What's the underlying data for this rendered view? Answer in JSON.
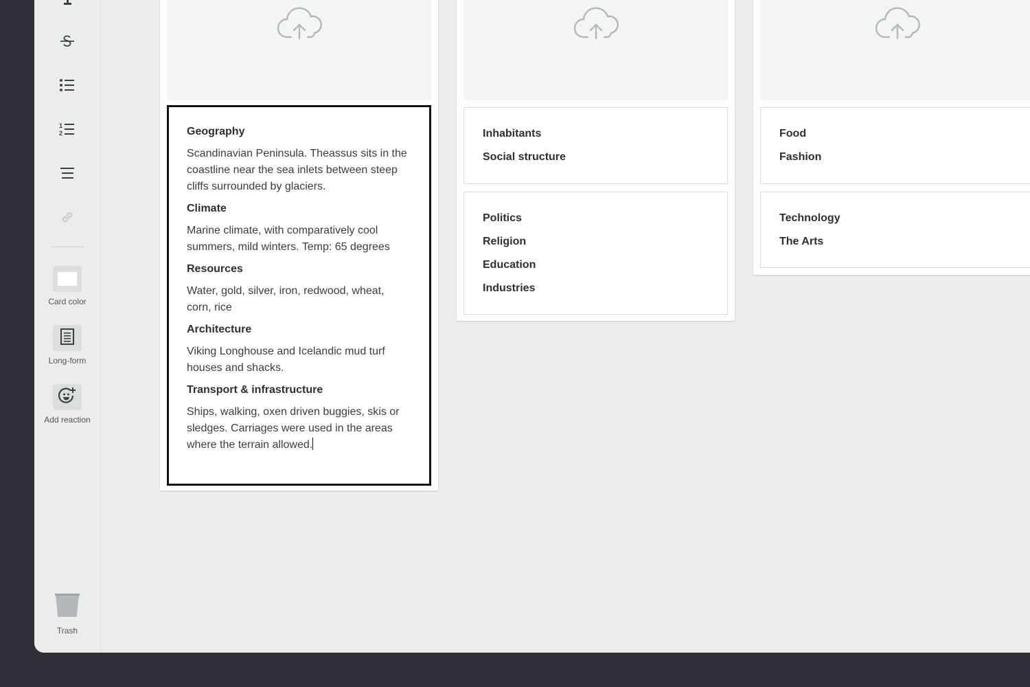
{
  "sidebar": {
    "tools": [
      {
        "name": "text-style",
        "icon": "text-icon"
      },
      {
        "name": "strikethrough",
        "icon": "strikethrough-icon"
      },
      {
        "name": "bulleted-list",
        "icon": "bulleted-list-icon"
      },
      {
        "name": "numbered-list",
        "icon": "numbered-list-icon"
      },
      {
        "name": "align",
        "icon": "align-icon"
      },
      {
        "name": "link",
        "icon": "link-icon",
        "disabled": true
      }
    ],
    "card_color_label": "Card color",
    "long_form_label": "Long-form",
    "add_reaction_label": "Add reaction",
    "trash_label": "Trash"
  },
  "columns": [
    {
      "cards": [
        {
          "active": true,
          "sections": [
            {
              "heading": "Geography",
              "text": "Scandinavian Peninsula. Theassus sits in the coastline near the sea inlets between steep cliffs surrounded by glaciers."
            },
            {
              "heading": "Climate",
              "text": "Marine climate, with comparatively cool summers, mild winters. Temp: 65 degrees"
            },
            {
              "heading": "Resources",
              "text": "Water, gold, silver, iron, redwood, wheat, corn, rice"
            },
            {
              "heading": "Architecture",
              "text": "Viking Longhouse and Icelandic mud turf houses and shacks."
            },
            {
              "heading": "Transport & infrastructure",
              "text": "Ships, walking, oxen driven buggies, skis or sledges. Carriages were used in the areas where the terrain allowed."
            }
          ]
        }
      ]
    },
    {
      "cards": [
        {
          "headings": [
            "Inhabitants",
            "Social structure"
          ]
        },
        {
          "headings": [
            "Politics",
            "Religion",
            "Education",
            "Industries"
          ]
        }
      ]
    },
    {
      "cards": [
        {
          "headings": [
            "Food",
            "Fashion"
          ]
        },
        {
          "headings": [
            "Technology",
            "The Arts"
          ]
        }
      ]
    }
  ],
  "colors": {
    "accent_border": "#111111",
    "card_color": "#ffffff"
  }
}
